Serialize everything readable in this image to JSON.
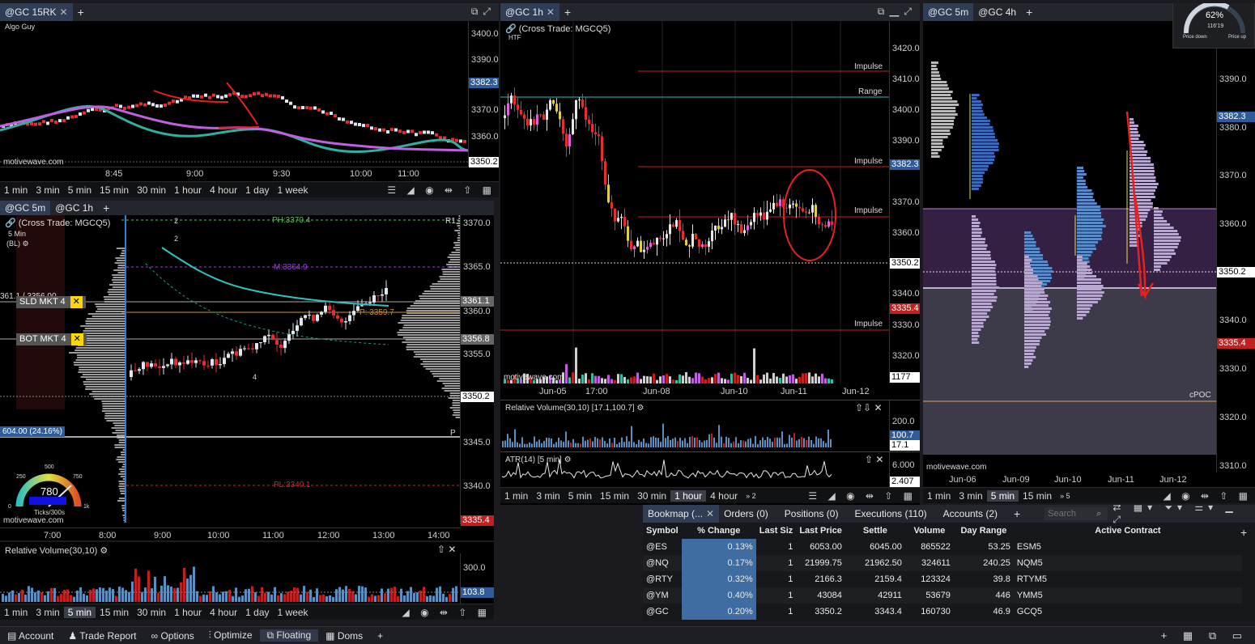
{
  "top_left": {
    "tabs": [
      "@GC 15RK"
    ],
    "author": "Algo Guy",
    "watermark": "motivewave.com",
    "price_ticks": [
      "3400.0",
      "3390.0",
      "3382.3",
      "3370.0",
      "3360.0",
      "3350.2"
    ],
    "highlight_box": "3382.3",
    "current_box": "3350.2",
    "time_ticks": [
      "8:45",
      "9:00",
      "9:30",
      "10:00",
      "11:00"
    ],
    "timeframes": [
      "1 min",
      "3 min",
      "5 min",
      "15 min",
      "30 min",
      "1 hour",
      "4 hour",
      "1 day",
      "1 week"
    ]
  },
  "mid_left": {
    "tabs": [
      "@GC 5m",
      "@GC 1h"
    ],
    "title": "(Cross Trade: MGCQ5)",
    "subtitle_1": "5 Min",
    "subtitle_2": "(BL)",
    "sld_label": "SLD MKT 4",
    "bot_label": "BOT MKT 4",
    "ph_label": "PH:3370.4",
    "m_label": "M:3364.9",
    "p_label": "P: 3359.7",
    "pl_label": "PL:3340.1",
    "r1": "R1",
    "p": "P",
    "left_price": "361.1 / 3356.00",
    "pos_pnl": "604.00 (24.16%)",
    "gauge_value": "780",
    "gauge_unit": "Ticks/300s",
    "gauge_ticks": [
      "250",
      "500",
      "750"
    ],
    "gauge_zero": "0",
    "gauge_k": "1k",
    "watermark": "motivewave.com",
    "markers": [
      "2",
      "2",
      "4"
    ],
    "price_ticks": [
      "3370.0",
      "3365.0",
      "3361.1",
      "3360.0",
      "3356.8",
      "3355.0",
      "3350.2",
      "3345.0",
      "3340.0",
      "3335.4"
    ],
    "time_ticks": [
      "7:00",
      "8:00",
      "9:00",
      "10:00",
      "11:00",
      "12:00",
      "13:00",
      "14:00"
    ]
  },
  "rel_vol_left": {
    "title": "Relative Volume(30,10)",
    "ticks": [
      "300.0",
      "103.8"
    ],
    "timeframes": [
      "1 min",
      "3 min",
      "5 min",
      "15 min",
      "30 min",
      "1 hour",
      "4 hour",
      "1 day",
      "1 week"
    ],
    "selected": "5 min"
  },
  "center": {
    "tabs": [
      "@GC 1h"
    ],
    "title": "(Cross Trade: MGCQ5)",
    "subtitle": "HTF",
    "levels": [
      "Impulse",
      "Range",
      "Impulse",
      "Impulse",
      "Impulse"
    ],
    "price_ticks": [
      "3420.0",
      "3410.0",
      "3400.0",
      "3390.0",
      "3382.3",
      "3370.0",
      "3360.0",
      "3350.2",
      "3340.0",
      "3335.4",
      "3330.0",
      "3320.0",
      "1177"
    ],
    "time_ticks": [
      "Jun-05",
      "17:00",
      "Jun-08",
      "Jun-10",
      "Jun-11",
      "Jun-12"
    ],
    "watermark": "motivewave.com",
    "rv_title": "Relative Volume(30,10) [17.1,100.7]",
    "rv_ticks": [
      "200.0",
      "100.7",
      "17.1"
    ],
    "atr_title": "ATR(14) [5 min]",
    "atr_ticks": [
      "6.000",
      "2.407"
    ],
    "timeframes": [
      "1 min",
      "3 min",
      "5 min",
      "15 min",
      "30 min",
      "1 hour",
      "4 hour"
    ],
    "tf_more": "2",
    "selected": "1 hour"
  },
  "right": {
    "tabs": [
      "@GC 5m",
      "@GC 4h"
    ],
    "price_ticks": [
      "3390.0",
      "3382.3",
      "3380.0",
      "3370.0",
      "3360.0",
      "3350.2",
      "3340.0",
      "3335.4",
      "3330.0",
      "3320.0",
      "3310.0"
    ],
    "time_ticks": [
      "Jun-06",
      "Jun-09",
      "Jun-10",
      "Jun-11",
      "Jun-12"
    ],
    "cpoc": "cPOC",
    "watermark": "motivewave.com",
    "timeframes": [
      "1 min",
      "3 min",
      "5 min",
      "15 min"
    ],
    "tf_more": "5",
    "selected": "5 min",
    "gauge": {
      "pct": "62%",
      "sub": "116'19",
      "left": "Price down",
      "right": "Price up"
    }
  },
  "watchlist": {
    "tabs": [
      "Bookmap (...",
      "Orders (0)",
      "Positions (0)",
      "Executions (110)",
      "Accounts (2)"
    ],
    "search_placeholder": "Search",
    "columns": [
      "Symbol",
      "% Change",
      "Last Siz",
      "Last Price",
      "Settle",
      "Volume",
      "Day Range",
      "Active Contract"
    ],
    "rows": [
      {
        "symbol": "@ES",
        "change": "0.13%",
        "size": "1",
        "last": "6053.00",
        "settle": "6045.00",
        "volume": "865522",
        "range": "53.25",
        "contract": "ESM5"
      },
      {
        "symbol": "@NQ",
        "change": "0.17%",
        "size": "1",
        "last": "21999.75",
        "settle": "21962.50",
        "volume": "324611",
        "range": "240.25",
        "contract": "NQM5"
      },
      {
        "symbol": "@RTY",
        "change": "0.32%",
        "size": "1",
        "last": "2166.3",
        "settle": "2159.4",
        "volume": "123324",
        "range": "39.8",
        "contract": "RTYM5"
      },
      {
        "symbol": "@YM",
        "change": "0.40%",
        "size": "1",
        "last": "43084",
        "settle": "42911",
        "volume": "53679",
        "range": "446",
        "contract": "YMM5"
      },
      {
        "symbol": "@GC",
        "change": "0.20%",
        "size": "1",
        "last": "3350.2",
        "settle": "3343.4",
        "volume": "160730",
        "range": "46.9",
        "contract": "GCQ5"
      }
    ]
  },
  "bottombar": {
    "items": [
      "Account",
      "Trade Report",
      "Options",
      "Optimize",
      "Floating",
      "Doms"
    ],
    "selected": "Floating"
  },
  "colors": {
    "accent": "#3e6ca3",
    "up": "#5b9bd5",
    "down": "#e03030",
    "magenta": "#c060e0",
    "teal": "#30b0a0"
  }
}
